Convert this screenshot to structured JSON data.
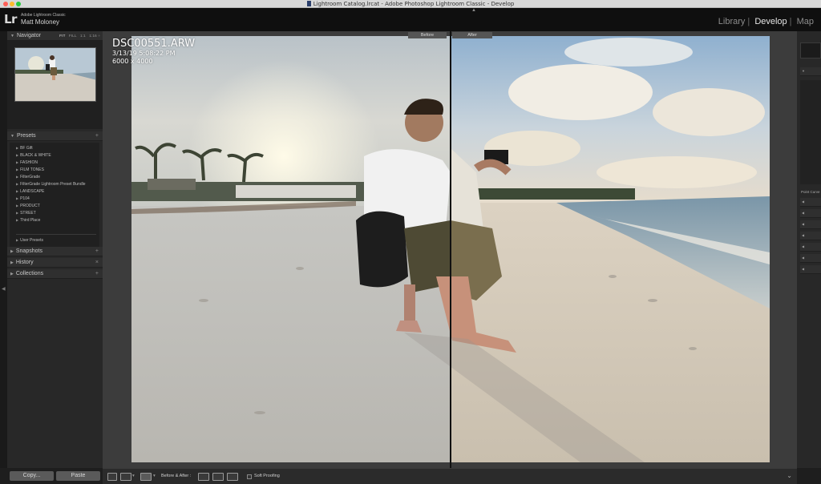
{
  "window": {
    "title": "Lightroom Catalog.lrcat - Adobe Photoshop Lightroom Classic - Develop",
    "traffic_lights": {
      "close": "#ff5f57",
      "minimize": "#febc2e",
      "zoom": "#28c840"
    }
  },
  "identity": {
    "logo": "Lr",
    "app_name": "Adobe Lightroom Classic",
    "user_name": "Matt Moloney"
  },
  "modules": {
    "library": "Library",
    "develop": "Develop",
    "map": "Map",
    "separator": "|"
  },
  "navigator": {
    "title": "Navigator",
    "options": {
      "fit": "FIT",
      "fill": "FILL",
      "one": "1:1",
      "zoom": "1:16 ÷"
    }
  },
  "presets": {
    "title": "Presets",
    "items": [
      "BF Gift",
      "BLACK & WHITE",
      "FASHION",
      "FILM TONES",
      "FilterGrade",
      "FilterGrade Lightroom Preset Bundle",
      "LANDSCAPE",
      "P104",
      "PRODUCT",
      "STREET",
      "Third Place"
    ],
    "user_presets": "User Presets"
  },
  "panels": {
    "snapshots": "Snapshots",
    "history": "History",
    "collections": "Collections"
  },
  "buttons": {
    "copy": "Copy...",
    "paste": "Paste"
  },
  "view": {
    "before_label": "Before",
    "after_label": "After",
    "filename": "DSC00551.ARW",
    "datetime": "3/13/19 5:08:22 PM",
    "dimensions": "6000 x 4000"
  },
  "right_panel": {
    "label": "Point Curve"
  },
  "toolbar": {
    "before_after": "Before & After :",
    "soft_proofing": "Soft Proofing"
  },
  "colors": {
    "title_bar": "#d8d8d8",
    "identity_bar": "#0f0f0f",
    "panel_bg": "#282828",
    "canvas_bg": "#3c3c3c",
    "module_active": "#e6e6e6",
    "module_inactive": "#8d8d8d"
  }
}
